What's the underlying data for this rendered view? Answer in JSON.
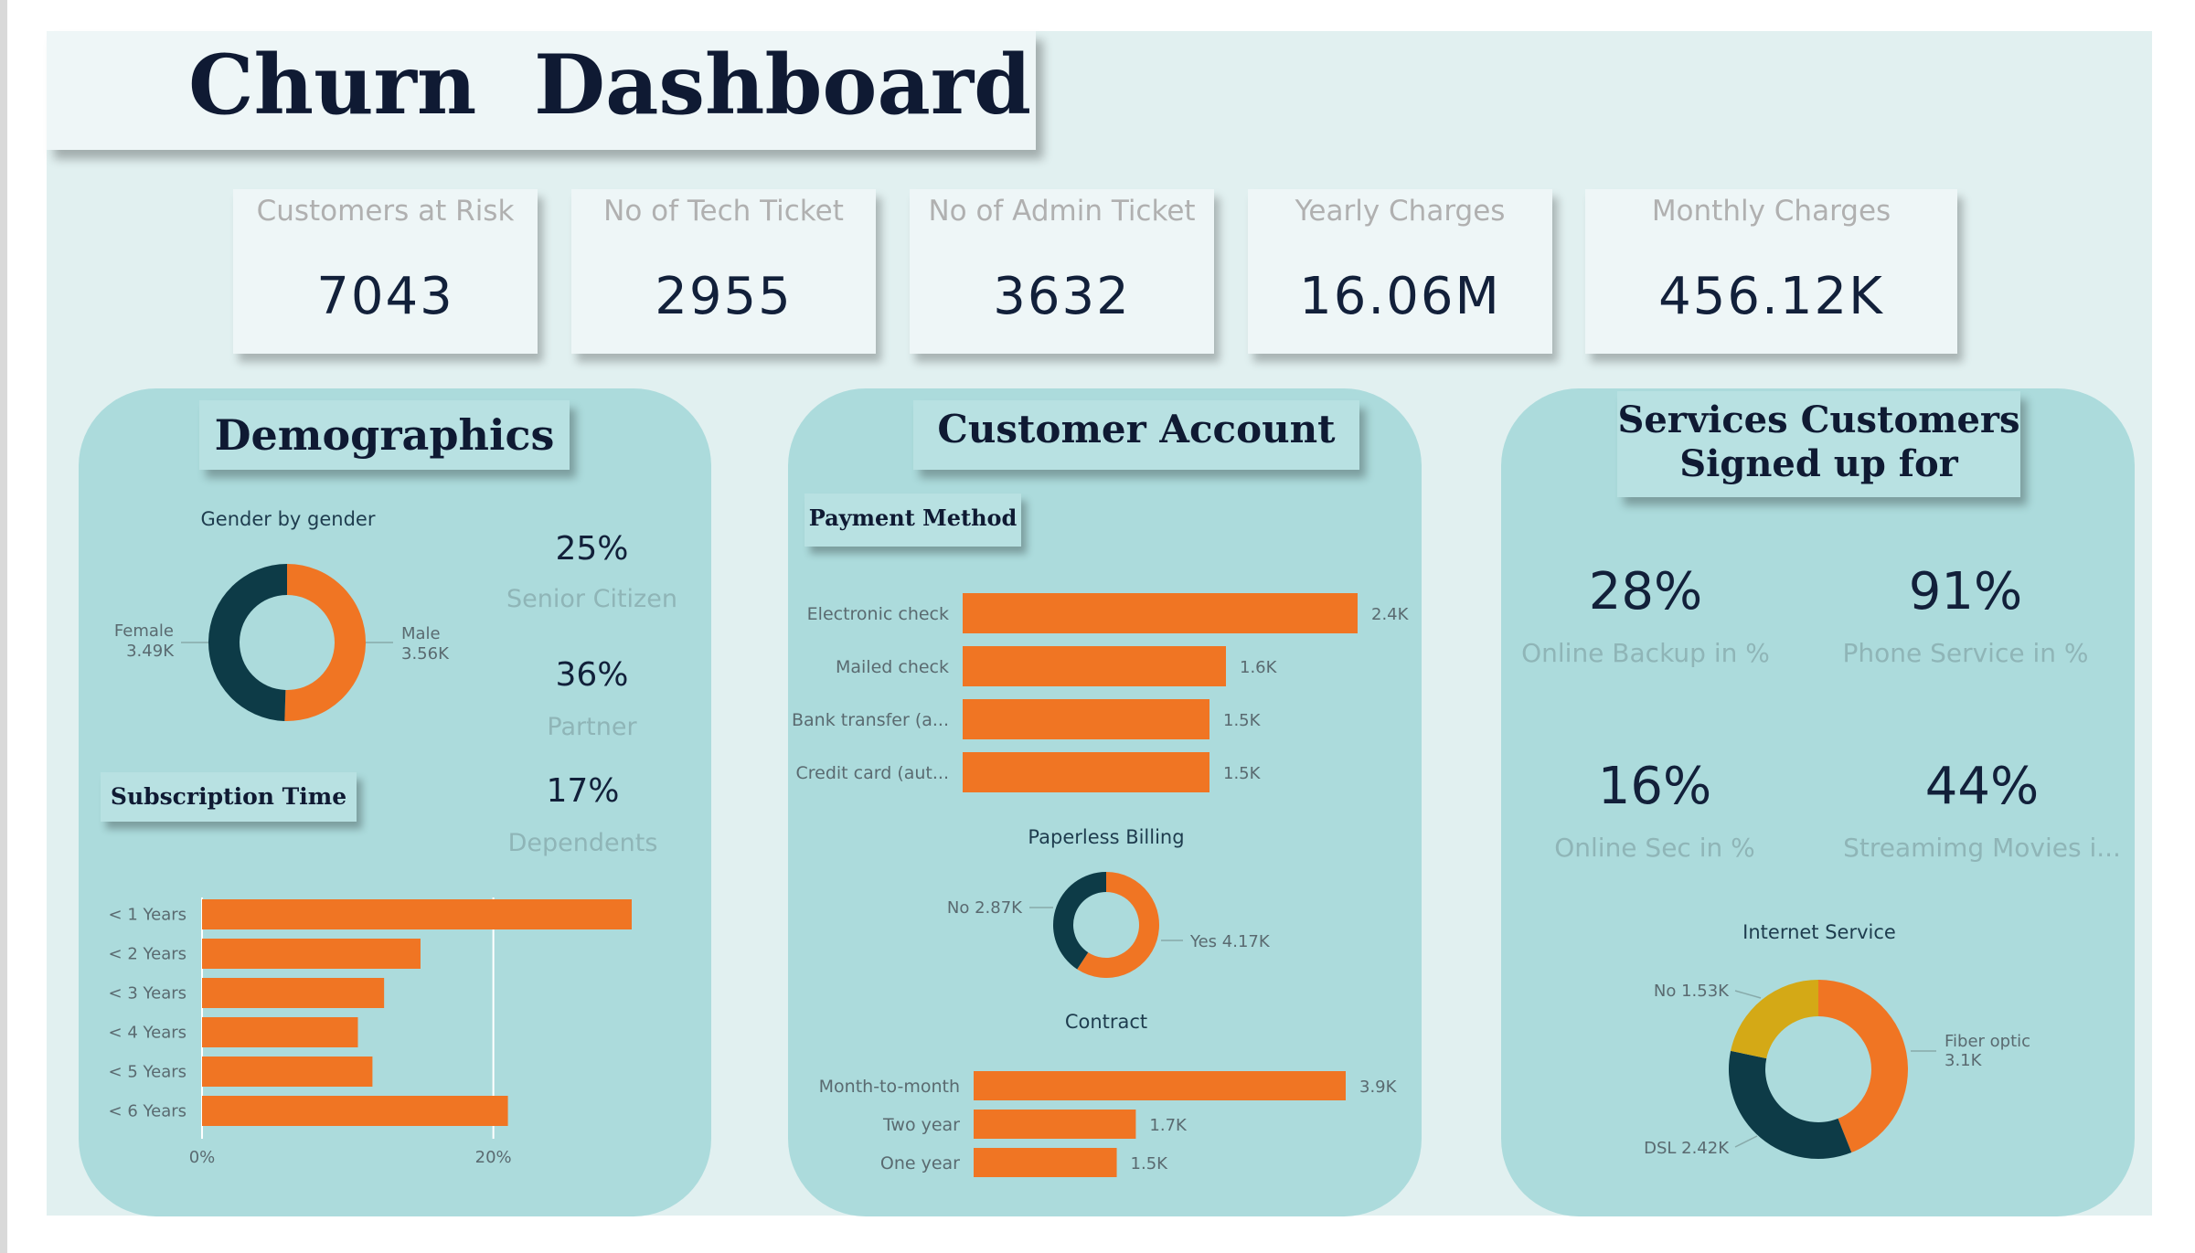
{
  "dashboard": {
    "title": "Churn  Dashboard"
  },
  "kpis": [
    {
      "label": "Customers at Risk",
      "value": "7043"
    },
    {
      "label": "No of Tech Ticket",
      "value": "2955"
    },
    {
      "label": "No of Admin Ticket",
      "value": "3632"
    },
    {
      "label": "Yearly Charges",
      "value": "16.06M"
    },
    {
      "label": "Monthly Charges",
      "value": "456.12K"
    }
  ],
  "colors": {
    "orange": "#f07523",
    "dark": "#0d3b47",
    "gold": "#d4a916",
    "panel": "#acdbdc",
    "canvas": "#e1f0f0"
  },
  "demographics": {
    "title": "Demographics",
    "stats": [
      {
        "value": "25%",
        "label": "Senior Citizen"
      },
      {
        "value": "36%",
        "label": "Partner"
      },
      {
        "value": "17%",
        "label": "Dependents"
      }
    ],
    "subscription_title": "Subscription Time"
  },
  "customer_account": {
    "title": "Customer Account",
    "payment_title": "Payment Method"
  },
  "services": {
    "title_line1": "Services Customers",
    "title_line2": "Signed up for",
    "stats": [
      {
        "value": "28%",
        "label": "Online Backup in %"
      },
      {
        "value": "91%",
        "label": "Phone Service in %"
      },
      {
        "value": "16%",
        "label": "Online Sec in %"
      },
      {
        "value": "44%",
        "label": "Streamimg Movies i..."
      }
    ]
  },
  "chart_data": [
    {
      "id": "gender",
      "type": "pie",
      "title": "Gender by gender",
      "slices": [
        {
          "name": "Male",
          "value": 3.56,
          "label": "3.56K",
          "color": "#f07523"
        },
        {
          "name": "Female",
          "value": 3.49,
          "label": "3.49K",
          "color": "#0d3b47"
        }
      ]
    },
    {
      "id": "subscription",
      "type": "bar",
      "orientation": "horizontal",
      "categories": [
        "< 1 Years",
        "< 2 Years",
        "< 3 Years",
        "< 4 Years",
        "< 5 Years",
        "< 6 Years"
      ],
      "values": [
        29.5,
        15.0,
        12.5,
        10.7,
        11.7,
        21.0
      ],
      "unit": "%",
      "xlim": [
        0,
        29.5
      ],
      "xticks": [
        {
          "value": 0,
          "label": "0%"
        },
        {
          "value": 20,
          "label": "20%"
        }
      ],
      "grid": true
    },
    {
      "id": "payment",
      "type": "bar",
      "orientation": "horizontal",
      "categories": [
        "Electronic check",
        "Mailed check",
        "Bank transfer (a...",
        "Credit card (aut..."
      ],
      "values": [
        2.4,
        1.6,
        1.5,
        1.5
      ],
      "data_labels": [
        "2.4K",
        "1.6K",
        "1.5K",
        "1.5K"
      ],
      "xlim": [
        0,
        2.4
      ]
    },
    {
      "id": "paperless",
      "type": "pie",
      "title": "Paperless Billing",
      "slices": [
        {
          "name": "Yes",
          "value": 4.17,
          "label": "4.17K",
          "color": "#f07523"
        },
        {
          "name": "No",
          "value": 2.87,
          "label": "2.87K",
          "color": "#0d3b47"
        }
      ]
    },
    {
      "id": "contract",
      "type": "bar",
      "orientation": "horizontal",
      "title": "Contract",
      "categories": [
        "Month-to-month",
        "Two year",
        "One year"
      ],
      "values": [
        3.9,
        1.7,
        1.5
      ],
      "data_labels": [
        "3.9K",
        "1.7K",
        "1.5K"
      ],
      "xlim": [
        0,
        3.9
      ]
    },
    {
      "id": "internet",
      "type": "pie",
      "title": "Internet Service",
      "slices": [
        {
          "name": "Fiber optic",
          "value": 3.1,
          "label": "3.1K",
          "color": "#f07523"
        },
        {
          "name": "DSL",
          "value": 2.42,
          "label": "2.42K",
          "color": "#0d3b47"
        },
        {
          "name": "No",
          "value": 1.53,
          "label": "1.53K",
          "color": "#d4a916"
        }
      ]
    }
  ]
}
